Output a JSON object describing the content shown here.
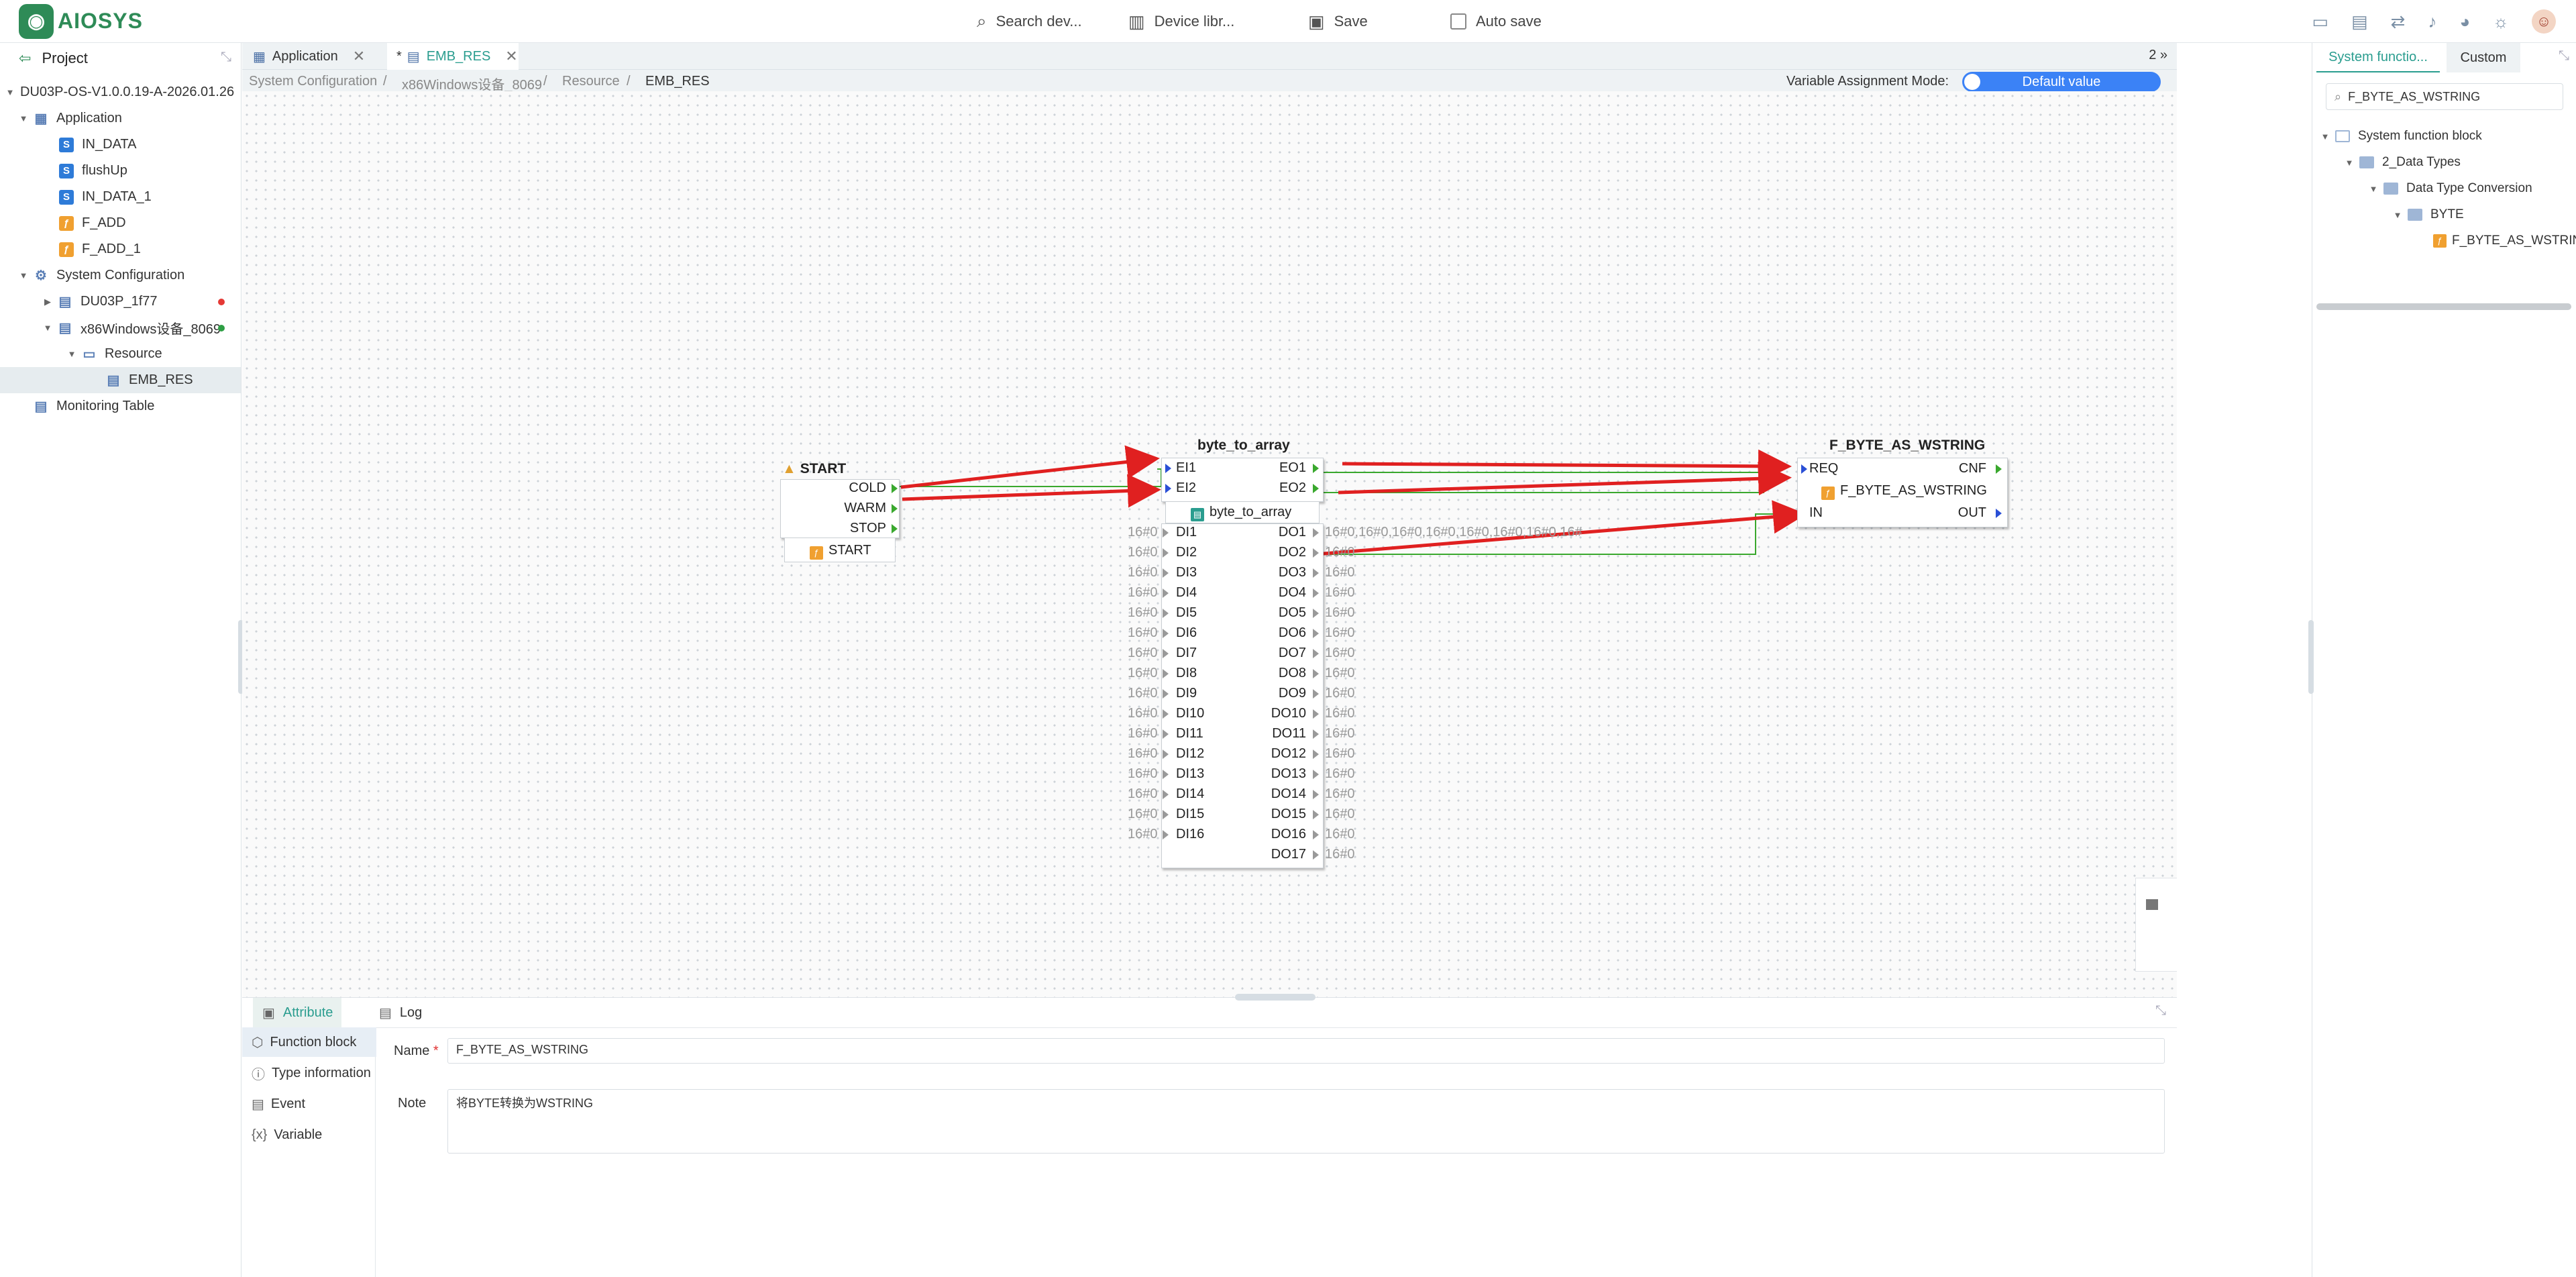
{
  "topbar": {
    "logo_text": "AIOSYS",
    "search_label": "Search dev...",
    "device_library_label": "Device libr...",
    "save_label": "Save",
    "autosave_label": "Auto save"
  },
  "project": {
    "header": "Project",
    "root": "DU03P-OS-V1.0.0.19-A-2026.01.26",
    "application": "Application",
    "items": [
      "IN_DATA",
      "flushUp",
      "IN_DATA_1",
      "F_ADD",
      "F_ADD_1"
    ],
    "system_configuration": "System Configuration",
    "device1": "DU03P_1f77",
    "device2": "x86Windows设备_8069",
    "resource": "Resource",
    "emb_res": "EMB_RES",
    "monitoring_table": "Monitoring Table",
    "status_colors": {
      "device1": "#e53935",
      "device2": "#2e9e44"
    }
  },
  "tabs": [
    {
      "label": "Application"
    },
    {
      "label": "EMB_RES",
      "modified": "*"
    }
  ],
  "tab_count": "2",
  "breadcrumb": [
    "System Configuration",
    "x86Windows设备_8069",
    "Resource",
    "EMB_RES"
  ],
  "variable_mode": {
    "label": "Variable Assignment Mode:",
    "value": "Default value"
  },
  "diagram": {
    "start": {
      "title": "START",
      "outputs": [
        "COLD",
        "WARM",
        "STOP"
      ],
      "type": "START"
    },
    "bta": {
      "title": "byte_to_array",
      "events_in": [
        "EI1",
        "EI2"
      ],
      "events_out": [
        "EO1",
        "EO2"
      ],
      "type": "byte_to_array",
      "inputs": [
        "DI1",
        "DI2",
        "DI3",
        "DI4",
        "DI5",
        "DI6",
        "DI7",
        "DI8",
        "DI9",
        "DI10",
        "DI11",
        "DI12",
        "DI13",
        "DI14",
        "DI15",
        "DI16"
      ],
      "outputs": [
        "DO1",
        "DO2",
        "DO3",
        "DO4",
        "DO5",
        "DO6",
        "DO7",
        "DO8",
        "DO9",
        "DO10",
        "DO11",
        "DO12",
        "DO13",
        "DO14",
        "DO15",
        "DO16",
        "DO17"
      ],
      "input_binding": "16#0",
      "do1_binding": "16#0,16#0,16#0,16#0,16#0,16#0,16#0,16#",
      "output_binding": "16#0"
    },
    "fbaw": {
      "title": "F_BYTE_AS_WSTRING",
      "events_in": [
        "REQ"
      ],
      "events_out": [
        "CNF"
      ],
      "type": "F_BYTE_AS_WSTRING",
      "inputs": [
        "IN"
      ],
      "outputs": [
        "OUT"
      ]
    },
    "colors": {
      "connection": "#3aa82e",
      "annotation": "#e02020"
    }
  },
  "bottom": {
    "tabs": [
      "Attribute",
      "Log"
    ],
    "nav": [
      "Function block",
      "Type information",
      "Event",
      "Variable"
    ],
    "name_label": "Name",
    "name_required": "*",
    "name_value": "F_BYTE_AS_WSTRING",
    "note_label": "Note",
    "note_value": "将BYTE转换为WSTRING"
  },
  "right": {
    "tabs": [
      "System functio...",
      "Custom"
    ],
    "search_value": "F_BYTE_AS_WSTRING",
    "tree": [
      "System function block",
      "2_Data Types",
      "Data Type Conversion",
      "BYTE",
      "F_BYTE_AS_WSTRING"
    ]
  }
}
